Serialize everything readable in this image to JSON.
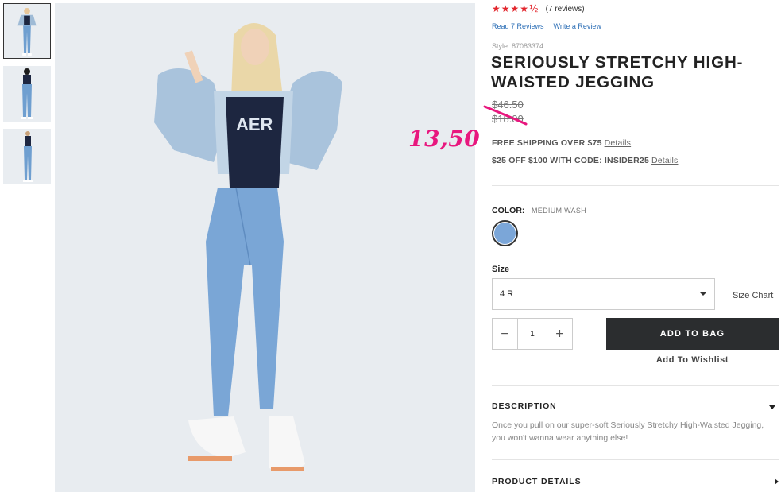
{
  "rating": {
    "stars": "★★★★½",
    "review_count": "(7 reviews)"
  },
  "review_links": {
    "read": "Read 7 Reviews",
    "write": "Write a Review"
  },
  "product": {
    "style": "Style: 87083374",
    "title": "SERIOUSLY STRETCHY HIGH-WAISTED JEGGING",
    "price_original": "$46.50",
    "price_sale": "$18.00",
    "handwritten_price": "13,50"
  },
  "promos": [
    {
      "text": "FREE SHIPPING OVER $75",
      "link": "Details"
    },
    {
      "text": "$25 OFF $100 WITH CODE: INSIDER25",
      "link": "Details"
    }
  ],
  "color": {
    "label": "COLOR:",
    "value": "MEDIUM WASH",
    "swatch_hex": "#7ba6d8"
  },
  "size": {
    "label": "Size",
    "selected": "4 R",
    "chart_link": "Size Chart"
  },
  "quantity": {
    "minus": "−",
    "value": "1",
    "plus": "+"
  },
  "actions": {
    "add_to_bag": "ADD TO BAG",
    "wishlist": "Add To Wishlist"
  },
  "description": {
    "heading": "DESCRIPTION",
    "text": "Once you pull on our super-soft Seriously Stretchy High-Waisted Jegging, you won't wanna wear anything else!"
  },
  "details": {
    "heading": "PRODUCT DETAILS"
  },
  "colors": {
    "accent_red": "#e2252c",
    "handwriting_pink": "#e8177e",
    "button_dark": "#2b2d2f",
    "link_blue": "#2a6db5"
  }
}
